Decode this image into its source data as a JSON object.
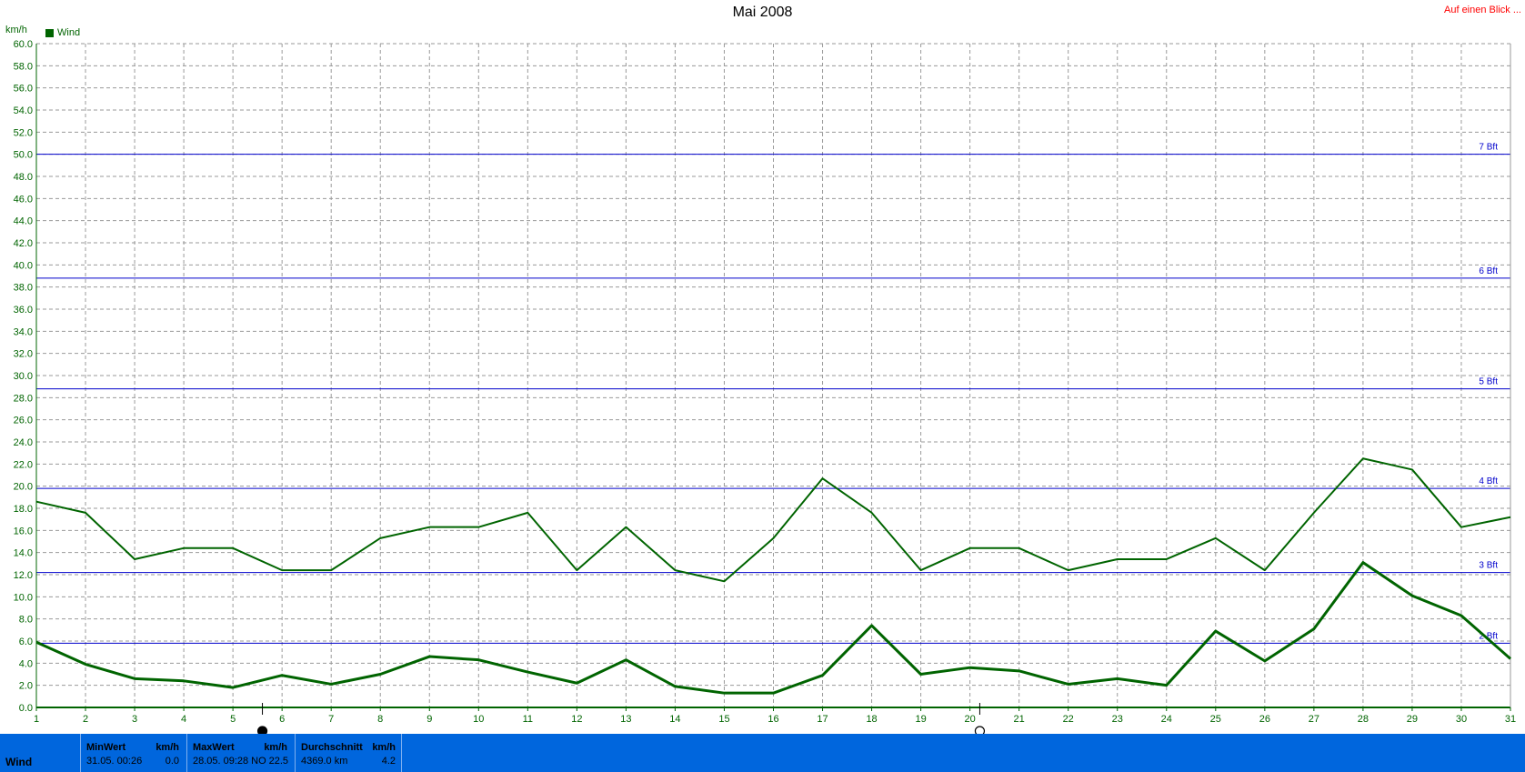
{
  "header": {
    "title": "Mai 2008",
    "at_a_glance_link": "Auf einen Blick ...",
    "unit_label": "km/h",
    "legend_label": "Wind",
    "legend_color": "#006400"
  },
  "chart_data": {
    "type": "line",
    "title": "Mai 2008",
    "ylabel": "km/h",
    "xlabel": "",
    "x": [
      1,
      2,
      3,
      4,
      5,
      6,
      7,
      8,
      9,
      10,
      11,
      12,
      13,
      14,
      15,
      16,
      17,
      18,
      19,
      20,
      21,
      22,
      23,
      24,
      25,
      26,
      27,
      28,
      29,
      30,
      31
    ],
    "xlim": [
      1,
      31
    ],
    "ylim": [
      0,
      60
    ],
    "ytick_step": 2,
    "grid": true,
    "legend_position": "top-left",
    "series": [
      {
        "name": "Wind",
        "role": "max",
        "color": "#006400",
        "values": [
          18.6,
          17.6,
          13.4,
          14.4,
          14.4,
          12.4,
          12.4,
          15.3,
          16.3,
          16.3,
          17.6,
          12.4,
          16.3,
          12.4,
          11.4,
          15.3,
          20.7,
          17.6,
          12.4,
          14.4,
          14.4,
          12.4,
          13.4,
          13.4,
          15.3,
          12.4,
          17.6,
          22.5,
          21.5,
          16.3,
          17.2
        ]
      },
      {
        "role": "mean",
        "color": "#006400",
        "values": [
          5.9,
          3.9,
          2.6,
          2.4,
          1.8,
          2.9,
          2.1,
          3.0,
          4.6,
          4.3,
          3.2,
          2.2,
          4.3,
          1.9,
          1.3,
          1.3,
          2.9,
          7.4,
          3.0,
          3.6,
          3.3,
          2.1,
          2.6,
          2.0,
          6.9,
          4.2,
          7.1,
          13.1,
          10.1,
          8.3,
          4.4
        ]
      }
    ],
    "reference_lines": [
      {
        "label": "2 Bft",
        "value": 5.8
      },
      {
        "label": "3 Bft",
        "value": 12.2
      },
      {
        "label": "4 Bft",
        "value": 19.8
      },
      {
        "label": "5 Bft",
        "value": 28.8
      },
      {
        "label": "6 Bft",
        "value": 38.8
      },
      {
        "label": "7 Bft",
        "value": 50.0
      }
    ],
    "reference_color": "#0000cc",
    "moon_markers": [
      {
        "phase": "new-moon",
        "x": 5.6
      },
      {
        "phase": "full-moon",
        "x": 20.2
      }
    ]
  },
  "footer": {
    "label": "Wind",
    "min": {
      "header": "MinWert",
      "unit": "km/h",
      "date": "31.05.",
      "time": "00:26",
      "value": "0.0"
    },
    "max": {
      "header": "MaxWert",
      "unit": "km/h",
      "date": "28.05.",
      "time": "09:28",
      "direction": "NO",
      "value": "22.5"
    },
    "avg": {
      "header": "Durchschnitt",
      "unit": "km/h",
      "distance": "4369.0 km",
      "value": "4.2"
    },
    "background": "#0066dd"
  }
}
